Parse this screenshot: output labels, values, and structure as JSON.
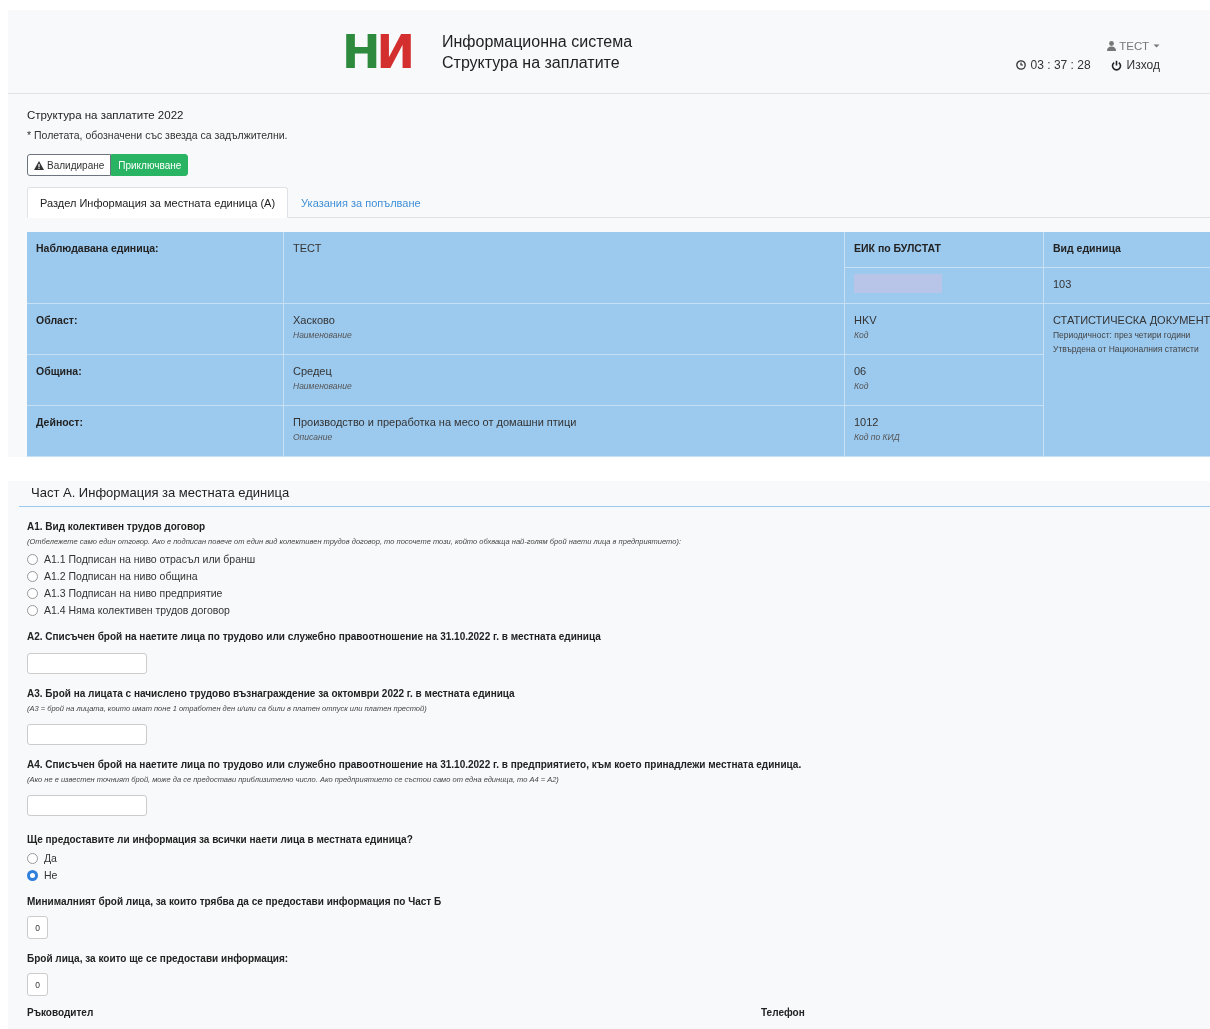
{
  "header": {
    "logo": "НИ",
    "title_lines": [
      "Информационна система",
      "Структура на заплатите"
    ],
    "user": "ТЕСТ",
    "clock": "03 : 37 : 28",
    "logout": "Изход"
  },
  "form": {
    "title": "Структура на заплатите 2022",
    "note": "* Полетата, обозначени със звезда са задължителни.",
    "buttons": [
      {
        "label": "Валидиране",
        "kind": "warning"
      },
      {
        "label": "Приключване",
        "kind": "success"
      }
    ],
    "tabs": [
      {
        "label": "Раздел Информация за местната единица (А)",
        "selected": true
      },
      {
        "label": "Указания за попълване",
        "selected": false
      }
    ]
  },
  "unit_table": {
    "observed": {
      "label": "Наблюдавана единица:",
      "value": "ТЕСТ"
    },
    "eik": {
      "label": "ЕИК по БУЛСТАТ",
      "redacted": true
    },
    "unit_type": {
      "label": "Вид единица",
      "value": "103"
    },
    "rows": [
      {
        "label": "Област:",
        "value": "Хасково",
        "value_hint": "Наименование",
        "code": "HKV",
        "code_hint": "Код"
      },
      {
        "label": "Община:",
        "value": "Средец",
        "value_hint": "Наименование",
        "code": "06",
        "code_hint": "Код"
      },
      {
        "label": "Дейност:",
        "value": "Производство и преработка на месо от домашни птици",
        "value_hint": "Описание",
        "code": "1012",
        "code_hint": "Код по КИД"
      }
    ],
    "document": {
      "title": "СТАТИСТИЧЕСКА ДОКУМЕНТ",
      "lines": [
        "Периодичност: през четири години",
        "Утвърдена от Националния статисти"
      ]
    }
  },
  "part_a": {
    "heading": "Част А. Информация за местната единица",
    "questions": [
      {
        "kind": "radio",
        "label": "А1. Вид колективен трудов договор",
        "note": "(Отбележете само един отговор. Ако е подписан повече от един вид колективен трудов договор, то посочете този, който обхваща най-голям брой наети лица в предприятието):",
        "options": [
          {
            "label": "А1.1 Подписан на ниво отрасъл или бранш",
            "selected": false
          },
          {
            "label": "А1.2 Подписан на ниво община",
            "selected": false
          },
          {
            "label": "А1.3 Подписан на ниво предприятие",
            "selected": false
          },
          {
            "label": "А1.4 Няма колективен трудов договор",
            "selected": false
          }
        ]
      },
      {
        "kind": "input",
        "label": "А2. Списъчен брой на наетите лица по трудово или служебно правоотношение на 31.10.2022 г. в местната единица"
      },
      {
        "kind": "input",
        "label": "А3. Брой на лицата с начислено трудово възнаграждение за октомври 2022 г. в местната единица",
        "note": "(А3 = брой на лицата, които имат поне 1 отработен ден и/или са били в платен отпуск или платен престой)"
      },
      {
        "kind": "input",
        "label": "А4. Списъчен брой на наетите лица по трудово или служебно правоотношение на 31.10.2022 г. в предприятието, към което принадлежи местната единица.",
        "note": "(Ако не е известен точният брой, може да се предостави приблизително число. Ако предприятието се състои само от една единица, то А4 = А2)"
      },
      {
        "kind": "radio",
        "label": "Ще предоставите ли информация за всички наети лица в местната единица?",
        "options": [
          {
            "label": "Да",
            "selected": false
          },
          {
            "label": "Не",
            "selected": true
          }
        ]
      },
      {
        "kind": "count",
        "label": "Минималният брой лица, за които трябва да се предостави информация по Част Б",
        "value": "0"
      },
      {
        "kind": "count",
        "label": "Брой лица, за които ще се предостави информация:",
        "value": "0"
      }
    ],
    "footer_labels": [
      "Ръководител",
      "Телефон"
    ]
  }
}
